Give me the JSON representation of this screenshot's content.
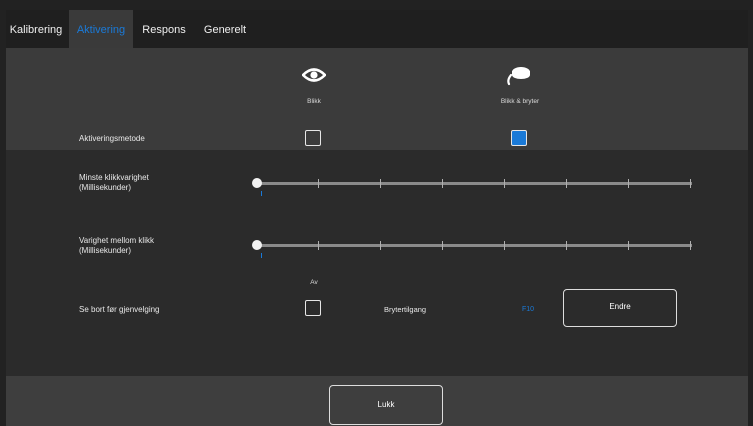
{
  "tabs": [
    {
      "label": "Kalibrering",
      "active": false
    },
    {
      "label": "Aktivering",
      "active": true
    },
    {
      "label": "Respons",
      "active": false
    },
    {
      "label": "Generelt",
      "active": false
    }
  ],
  "activation": {
    "method_label": "Aktiveringsmetode",
    "options": [
      {
        "label": "Blikk",
        "icon": "eye-icon",
        "checked": false
      },
      {
        "label": "Blikk & bryter",
        "icon": "switch-icon",
        "checked": true
      }
    ]
  },
  "sliders": [
    {
      "label_line1": "Minste klikkvarighet",
      "label_line2": "(Millisekunder)",
      "value_fraction": 0.0
    },
    {
      "label_line1": "Varighet mellom klikk",
      "label_line2": "(Millisekunder)",
      "value_fraction": 0.0
    }
  ],
  "look_away": {
    "label": "Se bort før gjenvelging",
    "checkbox_caption": "Av",
    "checked": false
  },
  "switch_access": {
    "label": "Brytertilgang",
    "key": "F10",
    "change_button": "Endre"
  },
  "footer": {
    "close_button": "Lukk"
  },
  "colors": {
    "accent": "#1a7ad8",
    "tab_bar": "#1f1f1f",
    "section_light": "#3b3b3b",
    "section_dark": "#2b2b2b"
  }
}
